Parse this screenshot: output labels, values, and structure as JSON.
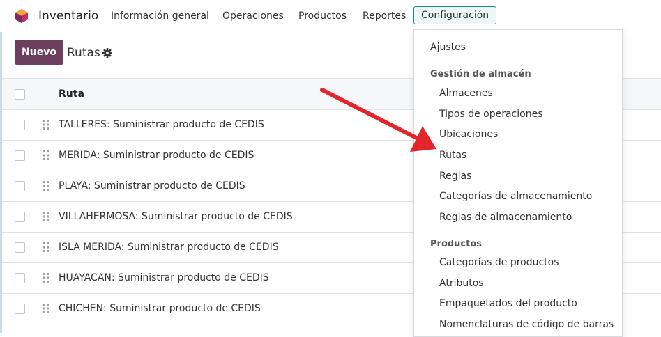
{
  "navbar": {
    "brand": "Inventario",
    "items": [
      "Información general",
      "Operaciones",
      "Productos",
      "Reportes"
    ],
    "active_item": "Configuración"
  },
  "control_panel": {
    "new_button": "Nuevo",
    "title": "Rutas"
  },
  "table": {
    "column_header": "Ruta",
    "rows": [
      "TALLERES: Suministrar producto de CEDIS",
      "MERIDA: Suministrar producto de CEDIS",
      "PLAYA: Suministrar producto de CEDIS",
      "VILLAHERMOSA: Suministrar producto de CEDIS",
      "ISLA MERIDA: Suministrar producto de CEDIS",
      "HUAYACAN: Suministrar producto de CEDIS",
      "CHICHEN: Suministrar producto de CEDIS"
    ]
  },
  "dropdown": {
    "settings": "Ajustes",
    "section_warehouse": "Gestión de almacén",
    "warehouse_items": [
      "Almacenes",
      "Tipos de operaciones",
      "Ubicaciones",
      "Rutas",
      "Reglas",
      "Categorías de almacenamiento",
      "Reglas de almacenamiento"
    ],
    "section_products": "Productos",
    "product_items": [
      "Categorías de productos",
      "Atributos",
      "Empaquetados del producto",
      "Nomenclaturas de código de barras"
    ]
  },
  "colors": {
    "primary": "#6c3f5e",
    "active_border": "#1a8a8a",
    "annotation_arrow": "#e3262b"
  }
}
